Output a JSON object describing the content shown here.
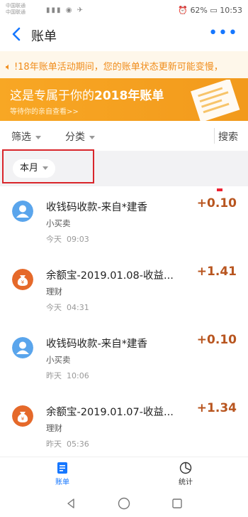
{
  "status_bar": {
    "carrier_1": "中国联通",
    "carrier_2": "中国联通",
    "battery": "62%",
    "time": "10:53"
  },
  "nav": {
    "title": "账单"
  },
  "notice": {
    "text": "!18年账单活动期间，您的账单状态更新可能变慢，"
  },
  "banner": {
    "title_prefix": "这是专属于你的",
    "title_year": "2018年账单",
    "subtitle": "等待你的亲自查看>>"
  },
  "filters": {
    "filter_label": "筛选",
    "category_label": "分类",
    "search_label": "搜索"
  },
  "month": {
    "label": "本月"
  },
  "transactions": [
    {
      "title": "收钱码收款-来自*建香",
      "category": "小买卖",
      "date": "今天",
      "time": "09:03",
      "amount": "+0.10",
      "icon": "person-icon"
    },
    {
      "title": "余额宝-2019.01.08-收益...",
      "category": "理财",
      "date": "今天",
      "time": "04:31",
      "amount": "+1.41",
      "icon": "money-bag-icon"
    },
    {
      "title": "收钱码收款-来自*建香",
      "category": "小买卖",
      "date": "昨天",
      "time": "10:06",
      "amount": "+0.10",
      "icon": "person-icon"
    },
    {
      "title": "余额宝-2019.01.07-收益...",
      "category": "理财",
      "date": "昨天",
      "time": "05:36",
      "amount": "+1.34",
      "icon": "money-bag-icon"
    }
  ],
  "tabs": {
    "bill_label": "账单",
    "stats_label": "统计"
  },
  "colors": {
    "accent": "#1677ff",
    "amount": "#b8551f",
    "notice": "#f08c1a",
    "banner": "#f8a724",
    "highlight": "#d9262b"
  }
}
